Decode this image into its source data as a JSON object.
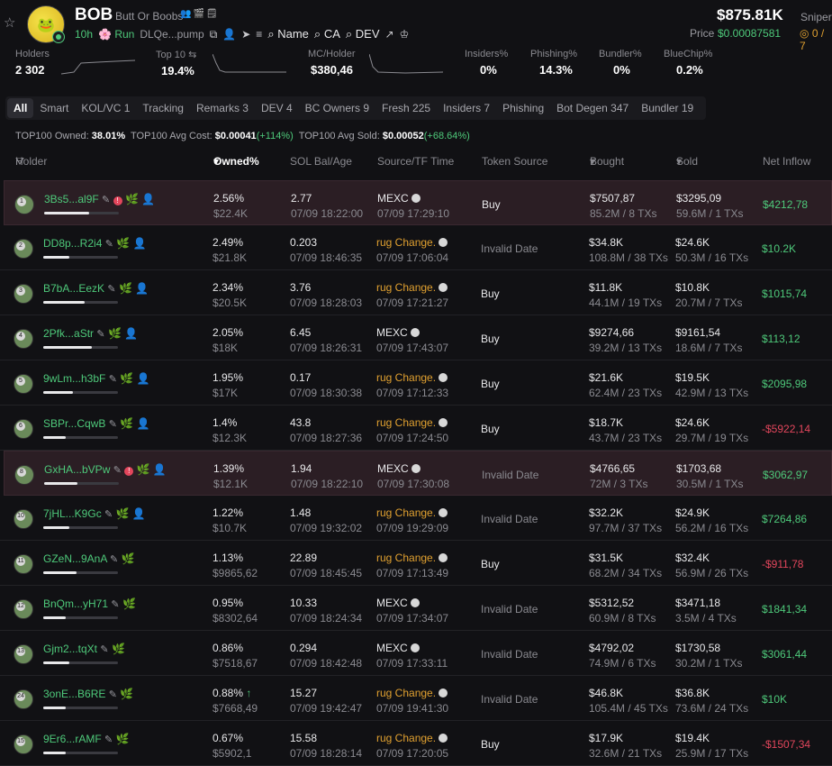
{
  "token": {
    "ticker": "BOB",
    "name": "Butt Or Boobs",
    "age": "10h",
    "run_label": "Run",
    "address": "DLQe...pump",
    "search_links": [
      "Name",
      "CA",
      "DEV"
    ],
    "market_cap": "$875.81K",
    "price_label": "Price",
    "price": "$0.00087581",
    "sniper_label": "Sniper",
    "sniper_value": "0 / 7"
  },
  "stats": [
    {
      "label": "Holders",
      "value": "2 302"
    },
    {
      "label": "Top 10",
      "value": "19.4%"
    },
    {
      "label": "MC/Holder",
      "value": "$380,46"
    },
    {
      "label": "Insiders%",
      "value": "0%"
    },
    {
      "label": "Phishing%",
      "value": "14.3%"
    },
    {
      "label": "Bundler%",
      "value": "0%"
    },
    {
      "label": "BlueChip%",
      "value": "0.2%"
    }
  ],
  "tabs": [
    "All",
    "Smart",
    "KOL/VC 1",
    "Tracking",
    "Remarks 3",
    "DEV 4",
    "BC Owners 9",
    "Fresh 225",
    "Insiders 7",
    "Phishing",
    "Bot Degen 347",
    "Bundler 19"
  ],
  "summary": {
    "owned_label": "TOP100 Owned:",
    "owned": "38.01%",
    "cost_label": "TOP100 Avg Cost:",
    "cost": "$0.00041",
    "cost_chg": "(+114%)",
    "sold_label": "TOP100 Avg Sold:",
    "sold": "$0.00052",
    "sold_chg": "(+68.64%)"
  },
  "columns": [
    "Holder",
    "Owned%",
    "SOL Bal/Age",
    "Source/TF Time",
    "Token Source",
    "Bought",
    "Sold",
    "Net Inflow"
  ],
  "holders": [
    {
      "rank": "1",
      "wallet": "3Bs5...al9F",
      "owned": "2.56%",
      "owned_usd": "$22.4K",
      "bar": 0.6,
      "sol": "2.77",
      "sol_time": "07/09 18:22:00",
      "src": "MEXC",
      "src_time": "07/09 17:29:10",
      "token_src": "Buy",
      "bought": "$7507,87",
      "bought_sub": "85.2M / 8 TXs",
      "sold": "$3295,09",
      "sold_sub": "59.6M / 1 TXs",
      "net": "$4212,78",
      "net_pos": true,
      "hl": true,
      "flag": true
    },
    {
      "rank": "2",
      "wallet": "DD8p...R2i4",
      "owned": "2.49%",
      "owned_usd": "$21.8K",
      "bar": 0.35,
      "sol": "0.203",
      "sol_time": "07/09 18:46:35",
      "src": "rug Change.",
      "src_time": "07/09 17:06:04",
      "token_src": "Invalid Date",
      "bought": "$34.8K",
      "bought_sub": "108.8M / 38 TXs",
      "sold": "$24.6K",
      "sold_sub": "50.3M / 16 TXs",
      "net": "$10.2K",
      "net_pos": true
    },
    {
      "rank": "3",
      "wallet": "B7bA...EezK",
      "owned": "2.34%",
      "owned_usd": "$20.5K",
      "bar": 0.55,
      "sol": "3.76",
      "sol_time": "07/09 18:28:03",
      "src": "rug Change.",
      "src_time": "07/09 17:21:27",
      "token_src": "Buy",
      "bought": "$11.8K",
      "bought_sub": "44.1M / 19 TXs",
      "sold": "$10.8K",
      "sold_sub": "20.7M / 7 TXs",
      "net": "$1015,74",
      "net_pos": true
    },
    {
      "rank": "4",
      "wallet": "2Pfk...aStr",
      "owned": "2.05%",
      "owned_usd": "$18K",
      "bar": 0.65,
      "sol": "6.45",
      "sol_time": "07/09 18:26:31",
      "src": "MEXC",
      "src_time": "07/09 17:43:07",
      "token_src": "Buy",
      "bought": "$9274,66",
      "bought_sub": "39.2M / 13 TXs",
      "sold": "$9161,54",
      "sold_sub": "18.6M / 7 TXs",
      "net": "$113,12",
      "net_pos": true
    },
    {
      "rank": "5",
      "wallet": "9wLm...h3bF",
      "owned": "1.95%",
      "owned_usd": "$17K",
      "bar": 0.4,
      "sol": "0.17",
      "sol_time": "07/09 18:30:38",
      "src": "rug Change.",
      "src_time": "07/09 17:12:33",
      "token_src": "Buy",
      "bought": "$21.6K",
      "bought_sub": "62.4M / 23 TXs",
      "sold": "$19.5K",
      "sold_sub": "42.9M / 13 TXs",
      "net": "$2095,98",
      "net_pos": true
    },
    {
      "rank": "6",
      "wallet": "SBPr...CqwB",
      "owned": "1.4%",
      "owned_usd": "$12.3K",
      "bar": 0.3,
      "sol": "43.8",
      "sol_time": "07/09 18:27:36",
      "src": "rug Change.",
      "src_time": "07/09 17:24:50",
      "token_src": "Buy",
      "bought": "$18.7K",
      "bought_sub": "43.7M / 23 TXs",
      "sold": "$24.6K",
      "sold_sub": "29.7M / 19 TXs",
      "net": "-$5922,14",
      "net_pos": false
    },
    {
      "rank": "8",
      "wallet": "GxHA...bVPw",
      "owned": "1.39%",
      "owned_usd": "$12.1K",
      "bar": 0.45,
      "sol": "1.94",
      "sol_time": "07/09 18:22:10",
      "src": "MEXC",
      "src_time": "07/09 17:30:08",
      "token_src": "Invalid Date",
      "bought": "$4766,65",
      "bought_sub": "72M / 3 TXs",
      "sold": "$1703,68",
      "sold_sub": "30.5M / 1 TXs",
      "net": "$3062,97",
      "net_pos": true,
      "hl": true,
      "flag": true
    },
    {
      "rank": "10",
      "wallet": "7jHL...K9Gc",
      "owned": "1.22%",
      "owned_usd": "$10.7K",
      "bar": 0.35,
      "sol": "1.48",
      "sol_time": "07/09 19:32:02",
      "src": "rug Change.",
      "src_time": "07/09 19:29:09",
      "token_src": "Invalid Date",
      "bought": "$32.2K",
      "bought_sub": "97.7M / 37 TXs",
      "sold": "$24.9K",
      "sold_sub": "56.2M / 16 TXs",
      "net": "$7264,86",
      "net_pos": true
    },
    {
      "rank": "11",
      "wallet": "GZeN...9AnA",
      "owned": "1.13%",
      "owned_usd": "$9865,62",
      "bar": 0.45,
      "sol": "22.89",
      "sol_time": "07/09 18:45:45",
      "src": "rug Change.",
      "src_time": "07/09 17:13:49",
      "token_src": "Buy",
      "bought": "$31.5K",
      "bought_sub": "68.2M / 34 TXs",
      "sold": "$32.4K",
      "sold_sub": "56.9M / 26 TXs",
      "net": "-$911,78",
      "net_pos": false
    },
    {
      "rank": "12",
      "wallet": "BnQm...yH71",
      "owned": "0.95%",
      "owned_usd": "$8302,64",
      "bar": 0.3,
      "sol": "10.33",
      "sol_time": "07/09 18:24:34",
      "src": "MEXC",
      "src_time": "07/09 17:34:07",
      "token_src": "Invalid Date",
      "bought": "$5312,52",
      "bought_sub": "60.9M / 8 TXs",
      "sold": "$3471,18",
      "sold_sub": "3.5M / 4 TXs",
      "net": "$1841,34",
      "net_pos": true
    },
    {
      "rank": "13",
      "wallet": "Gjm2...tqXt",
      "owned": "0.86%",
      "owned_usd": "$7518,67",
      "bar": 0.35,
      "sol": "0.294",
      "sol_time": "07/09 18:42:48",
      "src": "MEXC",
      "src_time": "07/09 17:33:11",
      "token_src": "Invalid Date",
      "bought": "$4792,02",
      "bought_sub": "74.9M / 6 TXs",
      "sold": "$1730,58",
      "sold_sub": "30.2M / 1 TXs",
      "net": "$3061,44",
      "net_pos": true
    },
    {
      "rank": "24",
      "wallet": "3onE...B6RE",
      "owned": "0.88%",
      "owned_usd": "$7668,49",
      "bar": 0.3,
      "sol": "15.27",
      "sol_time": "07/09 19:42:47",
      "src": "rug Change.",
      "src_time": "07/09 19:41:30",
      "token_src": "Invalid Date",
      "bought": "$46.8K",
      "bought_sub": "105.4M / 45 TXs",
      "sold": "$36.8K",
      "sold_sub": "73.6M / 24 TXs",
      "net": "$10K",
      "net_pos": true,
      "up": true
    },
    {
      "rank": "15",
      "wallet": "9Er6...rAMF",
      "owned": "0.67%",
      "owned_usd": "$5902,1",
      "bar": 0.3,
      "sol": "15.58",
      "sol_time": "07/09 18:28:14",
      "src": "rug Change.",
      "src_time": "07/09 17:20:05",
      "token_src": "Buy",
      "bought": "$17.9K",
      "bought_sub": "32.6M / 21 TXs",
      "sold": "$19.4K",
      "sold_sub": "25.9M / 17 TXs",
      "net": "-$1507,34",
      "net_pos": false
    }
  ]
}
